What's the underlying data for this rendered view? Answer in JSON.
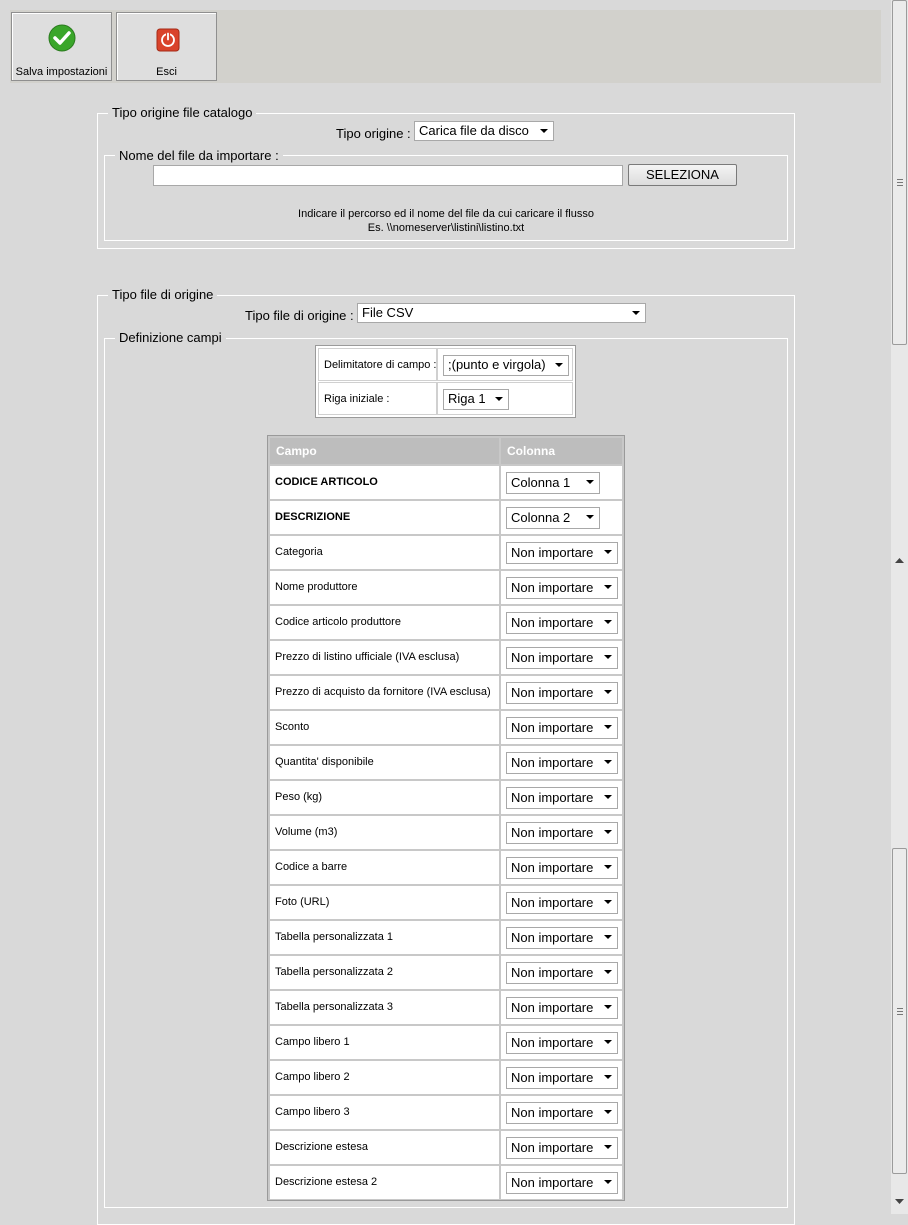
{
  "toolbar": {
    "save_label": "Salva impostazioni",
    "exit_label": "Esci"
  },
  "origine": {
    "legend": "Tipo origine file catalogo",
    "tipo_label": "Tipo origine :",
    "tipo_value": "Carica file da disco",
    "file_legend": "Nome del file da importare :",
    "file_value": "",
    "select_button": "SELEZIONA",
    "hint_line1": "Indicare il percorso ed il nome del file da cui caricare il flusso",
    "hint_line2": "Es. \\\\nomeserver\\listini\\listino.txt"
  },
  "tipo_file": {
    "legend": "Tipo file di origine",
    "label": "Tipo file di origine :",
    "value": "File CSV"
  },
  "definizione": {
    "legend": "Definizione campi",
    "delimitatore_label": "Delimitatore di campo :",
    "delimitatore_value": ";(punto e virgola)",
    "riga_label": "Riga iniziale :",
    "riga_value": "Riga 1"
  },
  "grid": {
    "headers": [
      "Campo",
      "Colonna"
    ],
    "rows": [
      {
        "name": "CODICE ARTICOLO",
        "value": "Colonna 1"
      },
      {
        "name": "DESCRIZIONE",
        "value": "Colonna 2"
      },
      {
        "name": "Categoria",
        "value": "Non importare"
      },
      {
        "name": "Nome produttore",
        "value": "Non importare"
      },
      {
        "name": "Codice articolo produttore",
        "value": "Non importare"
      },
      {
        "name": "Prezzo di listino ufficiale (IVA esclusa)",
        "value": "Non importare"
      },
      {
        "name": "Prezzo di acquisto da fornitore (IVA esclusa)",
        "value": "Non importare"
      },
      {
        "name": "Sconto",
        "value": "Non importare"
      },
      {
        "name": "Quantita' disponibile",
        "value": "Non importare"
      },
      {
        "name": "Peso (kg)",
        "value": "Non importare"
      },
      {
        "name": "Volume (m3)",
        "value": "Non importare"
      },
      {
        "name": "Codice a barre",
        "value": "Non importare"
      },
      {
        "name": "Foto (URL)",
        "value": "Non importare"
      },
      {
        "name": "Tabella personalizzata 1",
        "value": "Non importare"
      },
      {
        "name": "Tabella personalizzata 2",
        "value": "Non importare"
      },
      {
        "name": "Tabella personalizzata 3",
        "value": "Non importare"
      },
      {
        "name": "Campo libero 1",
        "value": "Non importare"
      },
      {
        "name": "Campo libero 2",
        "value": "Non importare"
      },
      {
        "name": "Campo libero 3",
        "value": "Non importare"
      },
      {
        "name": "Descrizione estesa",
        "value": "Non importare"
      },
      {
        "name": "Descrizione estesa 2",
        "value": "Non importare"
      }
    ]
  },
  "icons": {
    "save": "check-circle-icon",
    "exit": "power-icon"
  },
  "colors": {
    "save_green": "#3aa62a",
    "exit_red": "#d9432b"
  }
}
